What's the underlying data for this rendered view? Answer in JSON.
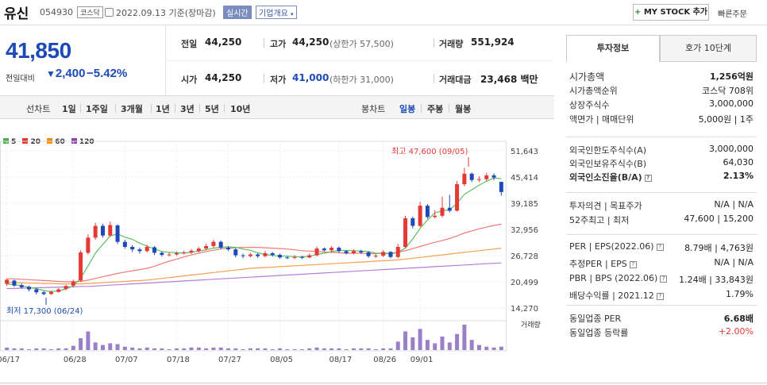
{
  "header": {
    "name": "유신",
    "code": "054930",
    "market": "코스닥",
    "date": "2022.09.13 기준(장마감)",
    "realtime": "실시간",
    "company_info": "기업개요",
    "mystock": "MY STOCK 추가",
    "quick_order": "빠른주문"
  },
  "price": {
    "current": "41,850",
    "change_label": "전일대비",
    "change": "2,400",
    "change_pct": "−5.42%"
  },
  "stats": {
    "prev_label": "전일",
    "prev": "44,250",
    "high_label": "고가",
    "high": "44,250",
    "upper_limit": "(상한가 57,500)",
    "volume_label": "거래량",
    "volume": "551,924",
    "open_label": "시가",
    "open": "44,250",
    "low_label": "저가",
    "low": "41,000",
    "lower_limit": "(하한가 31,000)",
    "amount_label": "거래대금",
    "amount": "23,468 백만"
  },
  "period_bar": {
    "line_chart": "선차트",
    "periods": [
      "1일",
      "1주일",
      "3개월",
      "1년",
      "3년",
      "5년",
      "10년"
    ],
    "candle_chart": "봉차트",
    "candle_periods": [
      "일봉",
      "주봉",
      "월봉"
    ]
  },
  "legend": [
    {
      "label": "5",
      "color": "#4caf50"
    },
    {
      "label": "20",
      "color": "#e53935"
    },
    {
      "label": "60",
      "color": "#fb8c00"
    },
    {
      "label": "120",
      "color": "#8e44ad"
    }
  ],
  "chart_data": {
    "type": "candlestick",
    "y_ticks": [
      "51,643",
      "45,414",
      "39,185",
      "32,956",
      "26,728",
      "20,499",
      "14,270"
    ],
    "y_range": [
      14270,
      51643
    ],
    "x_ticks": [
      "06/17",
      "06/28",
      "07/07",
      "07/18",
      "07/27",
      "08/05",
      "08/17",
      "08/26",
      "09/01"
    ],
    "high_annotation": "최고 47,600 (09/05)",
    "low_annotation": "최저 17,300 (06/24)",
    "volume_label": "거래량",
    "up_color": "#e53935",
    "down_color": "#1c4ab8",
    "candles": [
      [
        20000,
        21000,
        19500,
        21200
      ],
      [
        20800,
        19600,
        19300,
        21000
      ],
      [
        19700,
        19200,
        18800,
        20100
      ],
      [
        19300,
        18700,
        18200,
        19600
      ],
      [
        18700,
        18000,
        17500,
        19000
      ],
      [
        18000,
        17600,
        17300,
        18300
      ],
      [
        17600,
        18100,
        17400,
        18400
      ],
      [
        18100,
        18700,
        17900,
        19000
      ],
      [
        18800,
        19500,
        18500,
        19800
      ],
      [
        19600,
        20600,
        19300,
        21000
      ],
      [
        20800,
        27500,
        20500,
        28000
      ],
      [
        27400,
        31000,
        27000,
        31800
      ],
      [
        31000,
        33800,
        30500,
        34500
      ],
      [
        33800,
        31500,
        31000,
        34300
      ],
      [
        31500,
        34000,
        31200,
        34800
      ],
      [
        33900,
        30000,
        29500,
        34200
      ],
      [
        30000,
        28800,
        28400,
        30500
      ],
      [
        28800,
        28200,
        27600,
        29200
      ],
      [
        28200,
        27800,
        27200,
        28600
      ],
      [
        27800,
        28800,
        27500,
        29300
      ],
      [
        28700,
        27400,
        26900,
        29000
      ],
      [
        27400,
        26900,
        26500,
        27700
      ],
      [
        26900,
        27000,
        26500,
        27400
      ],
      [
        27000,
        27300,
        26700,
        27700
      ],
      [
        27300,
        27500,
        27000,
        27900
      ],
      [
        27500,
        27900,
        27100,
        28300
      ],
      [
        27800,
        28400,
        27500,
        28800
      ],
      [
        28400,
        29000,
        28000,
        29500
      ],
      [
        29000,
        30000,
        28600,
        30500
      ],
      [
        30000,
        28600,
        28300,
        30300
      ],
      [
        28600,
        28200,
        27800,
        29000
      ],
      [
        28200,
        26800,
        26300,
        28500
      ],
      [
        26800,
        26600,
        26100,
        27200
      ],
      [
        26600,
        27000,
        26300,
        27400
      ],
      [
        27000,
        26600,
        26200,
        27300
      ],
      [
        26600,
        27300,
        26300,
        27800
      ],
      [
        27300,
        26900,
        26500,
        27600
      ],
      [
        26900,
        26300,
        26000,
        27200
      ],
      [
        26300,
        26200,
        25900,
        26600
      ],
      [
        26200,
        26400,
        25900,
        26800
      ],
      [
        26400,
        26300,
        25900,
        26700
      ],
      [
        26300,
        26800,
        26100,
        27200
      ],
      [
        26800,
        28400,
        26500,
        28900
      ],
      [
        28400,
        28000,
        27700,
        28700
      ],
      [
        28000,
        28600,
        27600,
        29000
      ],
      [
        28600,
        27800,
        27400,
        28900
      ],
      [
        27800,
        27300,
        27000,
        28000
      ],
      [
        27300,
        27800,
        27000,
        28200
      ],
      [
        27800,
        27500,
        27100,
        28100
      ],
      [
        27500,
        26600,
        26200,
        27800
      ],
      [
        26600,
        26700,
        26200,
        27100
      ],
      [
        26700,
        27600,
        26400,
        28000
      ],
      [
        27600,
        26400,
        26100,
        27800
      ],
      [
        26400,
        28800,
        26100,
        29500
      ],
      [
        28800,
        35600,
        28500,
        36200
      ],
      [
        35600,
        33800,
        33200,
        36000
      ],
      [
        33800,
        38600,
        33500,
        39500
      ],
      [
        38600,
        35900,
        35500,
        39000
      ],
      [
        35900,
        36200,
        35600,
        37500
      ],
      [
        36200,
        38100,
        35800,
        40800
      ],
      [
        38100,
        37400,
        37000,
        41200
      ],
      [
        37400,
        43700,
        37200,
        44500
      ],
      [
        43700,
        46200,
        43200,
        47600
      ],
      [
        46200,
        44700,
        44200,
        46500
      ],
      [
        44700,
        44900,
        44200,
        45600
      ],
      [
        44900,
        45800,
        44500,
        46400
      ],
      [
        45800,
        45300,
        44700,
        46300
      ],
      [
        44250,
        41850,
        41000,
        44250
      ]
    ],
    "ma5": [
      20000,
      19800,
      19600,
      19200,
      18900,
      18400,
      18200,
      18300,
      18800,
      19500,
      21400,
      24300,
      27300,
      29400,
      31400,
      31900,
      31100,
      30600,
      29700,
      29000,
      28300,
      27700,
      27500,
      27400,
      27300,
      27500,
      27800,
      28100,
      28500,
      28700,
      28800,
      28700,
      28300,
      28000,
      27400,
      27000,
      26800,
      26600,
      26600,
      26500,
      26400,
      26600,
      27000,
      27300,
      27700,
      27900,
      28000,
      27900,
      27800,
      27700,
      27300,
      27300,
      27100,
      27500,
      28500,
      30700,
      33200,
      35200,
      36900,
      37400,
      37600,
      39200,
      41300,
      42400,
      43500,
      44400,
      45200,
      45000
    ],
    "ma20": [
      21300,
      21200,
      21100,
      21000,
      20900,
      20800,
      20700,
      20600,
      20500,
      20500,
      20600,
      20900,
      21300,
      21700,
      22100,
      22500,
      22800,
      23100,
      23400,
      23700,
      24200,
      24800,
      25400,
      25900,
      26400,
      26900,
      27300,
      27700,
      28000,
      28300,
      28500,
      28600,
      28700,
      28700,
      28700,
      28600,
      28500,
      28400,
      28300,
      28100,
      27900,
      27800,
      27700,
      27600,
      27500,
      27400,
      27300,
      27300,
      27300,
      27200,
      27200,
      27300,
      27300,
      27500,
      27900,
      28400,
      28900,
      29400,
      29900,
      30300,
      30800,
      31400,
      32100,
      32600,
      33100,
      33500,
      33900,
      34200
    ],
    "ma60": [
      20400,
      20300,
      20300,
      20200,
      20200,
      20100,
      20100,
      20000,
      20000,
      20000,
      20000,
      20100,
      20200,
      20300,
      20400,
      20500,
      20600,
      20700,
      20800,
      20900,
      21100,
      21300,
      21500,
      21700,
      21900,
      22100,
      22300,
      22500,
      22700,
      22900,
      23100,
      23300,
      23500,
      23700,
      23800,
      23900,
      24000,
      24100,
      24200,
      24300,
      24400,
      24500,
      24600,
      24700,
      24800,
      24900,
      25000,
      25100,
      25200,
      25300,
      25400,
      25500,
      25600,
      25700,
      25900,
      26100,
      26300,
      26500,
      26700,
      26900,
      27100,
      27300,
      27500,
      27700,
      27900,
      28100,
      28300,
      28500
    ],
    "ma120": [
      18900,
      18900,
      19000,
      19000,
      19100,
      19100,
      19200,
      19200,
      19300,
      19300,
      19400,
      19400,
      19500,
      19600,
      19700,
      19800,
      19900,
      20000,
      20100,
      20200,
      20300,
      20400,
      20500,
      20600,
      20700,
      20800,
      20900,
      21000,
      21100,
      21200,
      21300,
      21400,
      21500,
      21600,
      21700,
      21800,
      21900,
      22000,
      22100,
      22200,
      22300,
      22400,
      22500,
      22600,
      22700,
      22800,
      22900,
      23000,
      23100,
      23200,
      23300,
      23400,
      23500,
      23600,
      23700,
      23800,
      23900,
      24000,
      24100,
      24200,
      24300,
      24400,
      24500,
      24600,
      24700,
      24800,
      24900,
      25000
    ],
    "volume": [
      3,
      2,
      2,
      1,
      2,
      2,
      1,
      2,
      2,
      5,
      14,
      22,
      9,
      6,
      8,
      7,
      4,
      3,
      2,
      3,
      2,
      2,
      1,
      2,
      2,
      3,
      3,
      2,
      3,
      3,
      2,
      2,
      1,
      2,
      2,
      2,
      1,
      2,
      1,
      1,
      1,
      2,
      3,
      2,
      2,
      2,
      1,
      2,
      2,
      2,
      1,
      2,
      2,
      10,
      22,
      15,
      25,
      12,
      8,
      16,
      9,
      19,
      30,
      12,
      6,
      4,
      3,
      4
    ]
  },
  "invest_panel": {
    "tab_invest": "투자정보",
    "tab_quote": "호가 10단계",
    "rows1": [
      {
        "k": "시가총액",
        "v": "1,256억원"
      },
      {
        "k": "시가총액순위",
        "v": "코스닥 708위"
      },
      {
        "k": "상장주식수",
        "v": "3,000,000"
      },
      {
        "k": "액면가 | 매매단위",
        "v": "5,000원 | 1주"
      }
    ],
    "rows2": [
      {
        "k": "외국인한도주식수(A)",
        "v": "3,000,000"
      },
      {
        "k": "외국인보유주식수(B)",
        "v": "64,030"
      },
      {
        "k": "외국인소진율(B/A)",
        "v": "2.13%"
      }
    ],
    "rows3": [
      {
        "k": "투자의견 | 목표주가",
        "v": "N/A | N/A"
      },
      {
        "k": "52주최고 | 최저",
        "v": "47,600 | 15,200"
      }
    ],
    "rows4": [
      {
        "k": "PER | EPS(2022.06)",
        "v": "8.79배 | 4,763원"
      },
      {
        "k": "추정PER | EPS",
        "v": "N/A | N/A"
      },
      {
        "k": "PBR | BPS (2022.06)",
        "v": "1.24배 | 33,843원"
      },
      {
        "k": "배당수익률 | 2021.12",
        "v": "1.79%"
      }
    ],
    "rows5": [
      {
        "k": "동일업종 PER",
        "v": "6.68배"
      },
      {
        "k": "동일업종 등락률",
        "v": "+2.00%"
      }
    ]
  }
}
